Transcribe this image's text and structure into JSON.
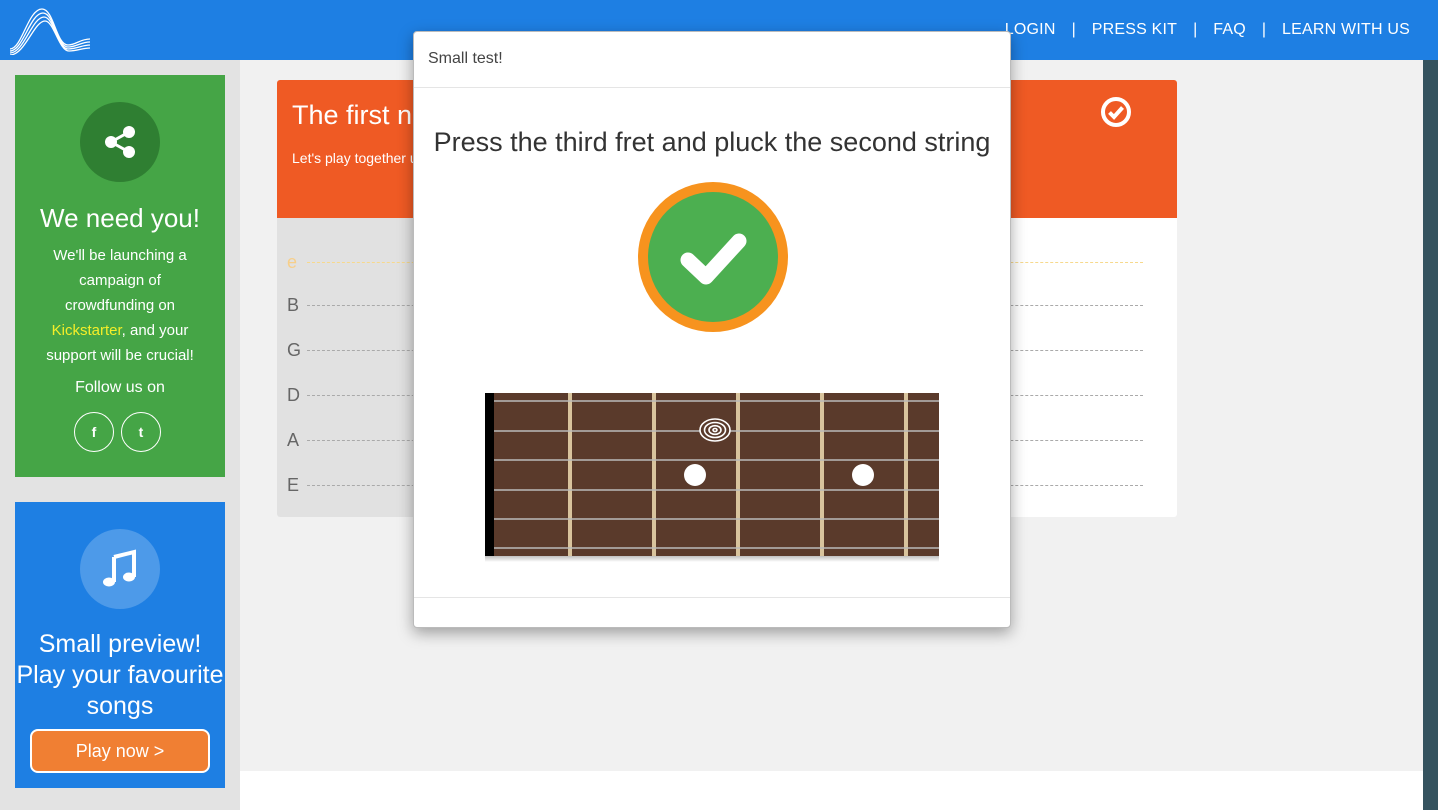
{
  "header": {
    "nav": [
      "LOGIN",
      "PRESS KIT",
      "FAQ",
      "LEARN WITH US"
    ],
    "separator": "|"
  },
  "sidebar": {
    "support_card": {
      "icon": "share-icon",
      "title": "We need you!",
      "text_before": "We'll be launching a campaign of crowdfunding on ",
      "highlight": "Kickstarter",
      "text_after": ", and your support will be crucial!",
      "follow": "Follow us on",
      "social": [
        {
          "name": "facebook-icon",
          "glyph": "f"
        },
        {
          "name": "twitter-icon",
          "glyph": "t"
        }
      ]
    },
    "preview_card": {
      "icon": "music-note-icon",
      "title": "Small preview! Play your favourite songs",
      "button": "Play now >"
    }
  },
  "lesson": {
    "title": "The first no",
    "text": "Let's play together                                                                                                                   used a lot and will come in handy even outs",
    "strings": [
      "e",
      "B",
      "G",
      "D",
      "A",
      "E"
    ],
    "highlighted_string": "e"
  },
  "modal": {
    "title": "Small test!",
    "question": "Press the third fret and pluck the second string",
    "result": "correct"
  },
  "colors": {
    "header": "#1e7fe3",
    "support_card": "#45a546",
    "preview_card": "#1e7fe3",
    "lesson_header": "#ef5a24",
    "success": "#4caf50",
    "success_ring": "#f7931e",
    "fretboard": "#5a3a2b"
  }
}
